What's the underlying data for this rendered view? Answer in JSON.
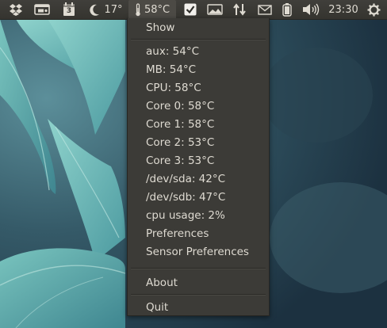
{
  "topbar": {
    "weather_temp": "17°",
    "sensor_temp": "58°C",
    "calendar_day": "3",
    "clock": "23:30",
    "icons": [
      "dropbox-icon",
      "display-icon",
      "calendar-icon",
      "moon-icon",
      "thermometer-icon",
      "checkbox-icon",
      "landscape-icon",
      "transfer-arrows-icon",
      "mail-icon",
      "battery-icon",
      "volume-icon",
      "gear-power-icon"
    ]
  },
  "menu": {
    "show": "Show",
    "sensors": [
      "aux: 54°C",
      "MB: 54°C",
      "CPU: 58°C",
      "Core 0: 58°C",
      "Core 1: 58°C",
      "Core 2: 53°C",
      "Core 3: 53°C",
      "/dev/sda: 42°C",
      "/dev/sdb: 47°C",
      "cpu usage: 2%"
    ],
    "preferences": "Preferences",
    "sensor_preferences": "Sensor Preferences",
    "about": "About",
    "quit": "Quit"
  },
  "colors": {
    "panel": "#3a3934",
    "menu_bg": "#3c3b37",
    "text": "#dfdbd2",
    "wallpaper_dark": "#1f3644",
    "leaf": "#6fb8b4"
  }
}
